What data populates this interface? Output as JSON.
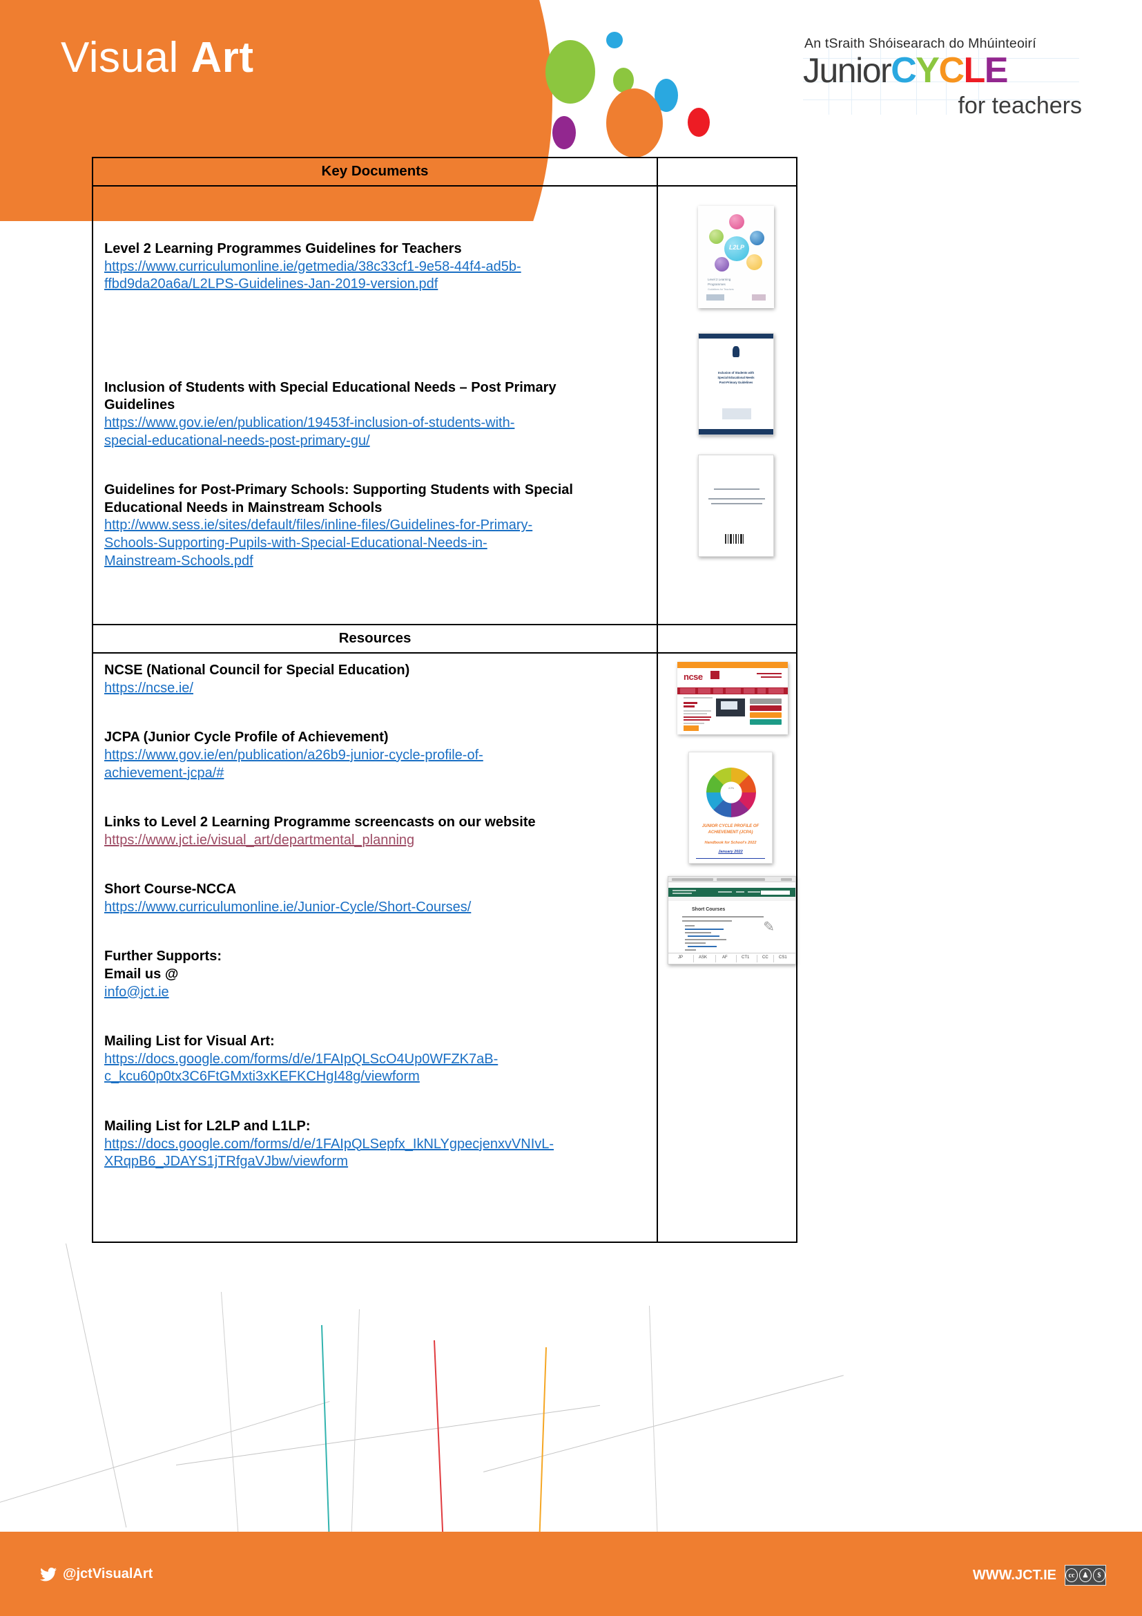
{
  "header": {
    "title_light": "Visual ",
    "title_bold": "Art",
    "logo": {
      "tagline": "An tSraith Shóisearach do Mhúinteoirí",
      "word_junior": "Junior",
      "word_c1": "C",
      "word_y": "Y",
      "word_c2": "C",
      "word_l": "L",
      "word_e": "E",
      "for_teachers": "for teachers"
    },
    "colors": {
      "orange": "#ef7e30",
      "green": "#8cc63f",
      "blue": "#2aa8e0",
      "red": "#ed1c24",
      "purple": "#92278f"
    }
  },
  "table": {
    "sections": [
      {
        "heading": "Key Documents",
        "entries": [
          {
            "title": "Level 2 Learning Programmes Guidelines for Teachers",
            "url_lines": [
              "https://www.curriculumonline.ie/getmedia/38c33cf1-9e58-44f4-ad5b-",
              "ffbd9da20a6a/L2LPS-Guidelines-Jan-2019-version.pdf"
            ],
            "link_state": "unvisited",
            "thumb": "l2lp-guidelines-cover"
          },
          {
            "title_lines": [
              "Inclusion of Students with Special Educational Needs – Post Primary",
              "Guidelines"
            ],
            "url_lines": [
              "https://www.gov.ie/en/publication/19453f-inclusion-of-students-with-",
              "special-educational-needs-post-primary-gu/"
            ],
            "link_state": "unvisited",
            "thumb": "inclusion-guidelines-cover"
          },
          {
            "title_lines": [
              "Guidelines for Post-Primary Schools: Supporting Students with Special",
              "Educational Needs in Mainstream Schools"
            ],
            "url_lines": [
              "http://www.sess.ie/sites/default/files/inline-files/Guidelines-for-Primary-",
              "Schools-Supporting-Pupils-with-Special-Educational-Needs-in-",
              "Mainstream-Schools.pdf"
            ],
            "link_state": "unvisited",
            "thumb": "sess-guidelines-cover"
          }
        ]
      },
      {
        "heading": "Resources",
        "entries": [
          {
            "title": "NCSE (National Council for Special Education)",
            "url_lines": [
              "https://ncse.ie/"
            ],
            "link_state": "unvisited",
            "thumb": "ncse-website-screenshot"
          },
          {
            "title": "JCPA (Junior Cycle Profile of Achievement)",
            "url_lines": [
              "https://www.gov.ie/en/publication/a26b9-junior-cycle-profile-of-",
              "achievement-jcpa/#"
            ],
            "link_state": "unvisited",
            "thumb": "jcpa-handbook-cover"
          },
          {
            "title": "Links to Level 2 Learning Programme screencasts on our website",
            "url_lines": [
              "https://www.jct.ie/visual_art/departmental_planning"
            ],
            "link_state": "visited"
          },
          {
            "title": "Short Course-NCCA",
            "url_lines": [
              "https://www.curriculumonline.ie/Junior-Cycle/Short-Courses/"
            ],
            "link_state": "unvisited",
            "thumb": "short-courses-website-screenshot"
          },
          {
            "title": "Further Supports:",
            "title2": "Email us @",
            "url_lines": [
              "info@jct.ie"
            ],
            "link_state": "unvisited"
          },
          {
            "title": "Mailing List for Visual Art:",
            "url_lines": [
              "https://docs.google.com/forms/d/e/1FAIpQLScO4Up0WFZK7aB-",
              "c_kcu60p0tx3C6FtGMxti3xKEFKCHgI48g/viewform"
            ],
            "link_state": "unvisited"
          },
          {
            "title": "Mailing List for L2LP and L1LP:",
            "url_lines": [
              "https://docs.google.com/forms/d/e/1FAIpQLSepfx_IkNLYgpecjenxvVNIvL-",
              "XRqpB6_JDAYS1jTRfgaVJbw/viewform"
            ],
            "link_state": "unvisited"
          }
        ]
      }
    ]
  },
  "thumbnails": {
    "l2lp": {
      "center_label": "L2LP",
      "caption_l1": "Level 2 Learning",
      "caption_l2": "Programmes",
      "caption_l3": "Guidelines for Teachers"
    },
    "inclusion": {
      "t1": "Inclusion of Students with",
      "t2": "Special Educational Needs",
      "t3": "Post-Primary Guidelines"
    },
    "jcpa": {
      "title_l1": "JUNIOR CYCLE PROFILE OF",
      "title_l2": "ACHIEVEMENT (JCPA)",
      "sub": "Handbook for School's 2022",
      "date": "January 2022"
    },
    "shortcourses": {
      "heading": "Short Courses",
      "tabs": [
        "JP",
        "ASK",
        "AF",
        "CT1",
        "CC",
        "CS1"
      ]
    },
    "ncse": {
      "logo": "ncse"
    }
  },
  "footer": {
    "twitter_handle": "@jctVisualArt",
    "website": "WWW.JCT.IE",
    "cc_by": "BY",
    "cc_nc": "NC",
    "cc_cc": "cc",
    "background": "#ef7e30"
  }
}
